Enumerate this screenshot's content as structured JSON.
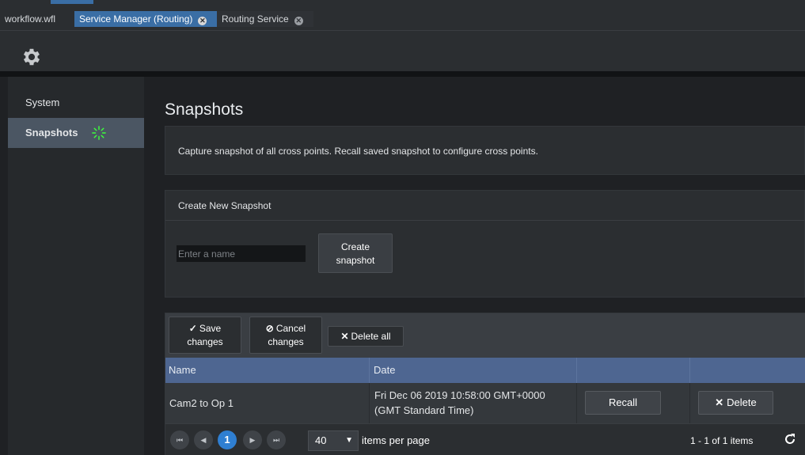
{
  "tabs": [
    {
      "label": "workflow.wfl"
    },
    {
      "label": "Service Manager (Routing)"
    },
    {
      "label": "Routing Service"
    }
  ],
  "toolbar": {
    "icon": "gear-icon"
  },
  "sidebar": {
    "items": [
      {
        "label": "System"
      },
      {
        "label": "Snapshots",
        "status_icon": "loading-spinner-icon"
      }
    ]
  },
  "main": {
    "title": "Snapshots",
    "description": "Capture snapshot of all cross points. Recall saved snapshot to configure cross points.",
    "create": {
      "header": "Create New Snapshot",
      "input_placeholder": "Enter a name",
      "button_line1": "Create",
      "button_line2": "snapshot"
    },
    "grid": {
      "toolbar": {
        "save_line1": "Save",
        "save_line2": "changes",
        "cancel_line1": "Cancel",
        "cancel_line2": "changes",
        "delete_all": "Delete all"
      },
      "columns": [
        "Name",
        "Date",
        "",
        ""
      ],
      "rows": [
        {
          "name": "Cam2 to Op 1",
          "date_line1": "Fri Dec 06 2019 10:58:00 GMT+0000",
          "date_line2": "(GMT Standard Time)",
          "recall_label": "Recall",
          "delete_label": "Delete"
        }
      ],
      "pager": {
        "current_page": "1",
        "page_size": "40",
        "items_per_page_label": "items per page",
        "info": "1 - 1 of 1 items"
      }
    }
  },
  "colors": {
    "accent_tab": "#3a6ea5",
    "grid_header": "#4e6691",
    "current_page": "#2f7fd2",
    "spinner": "#3cff3c"
  }
}
